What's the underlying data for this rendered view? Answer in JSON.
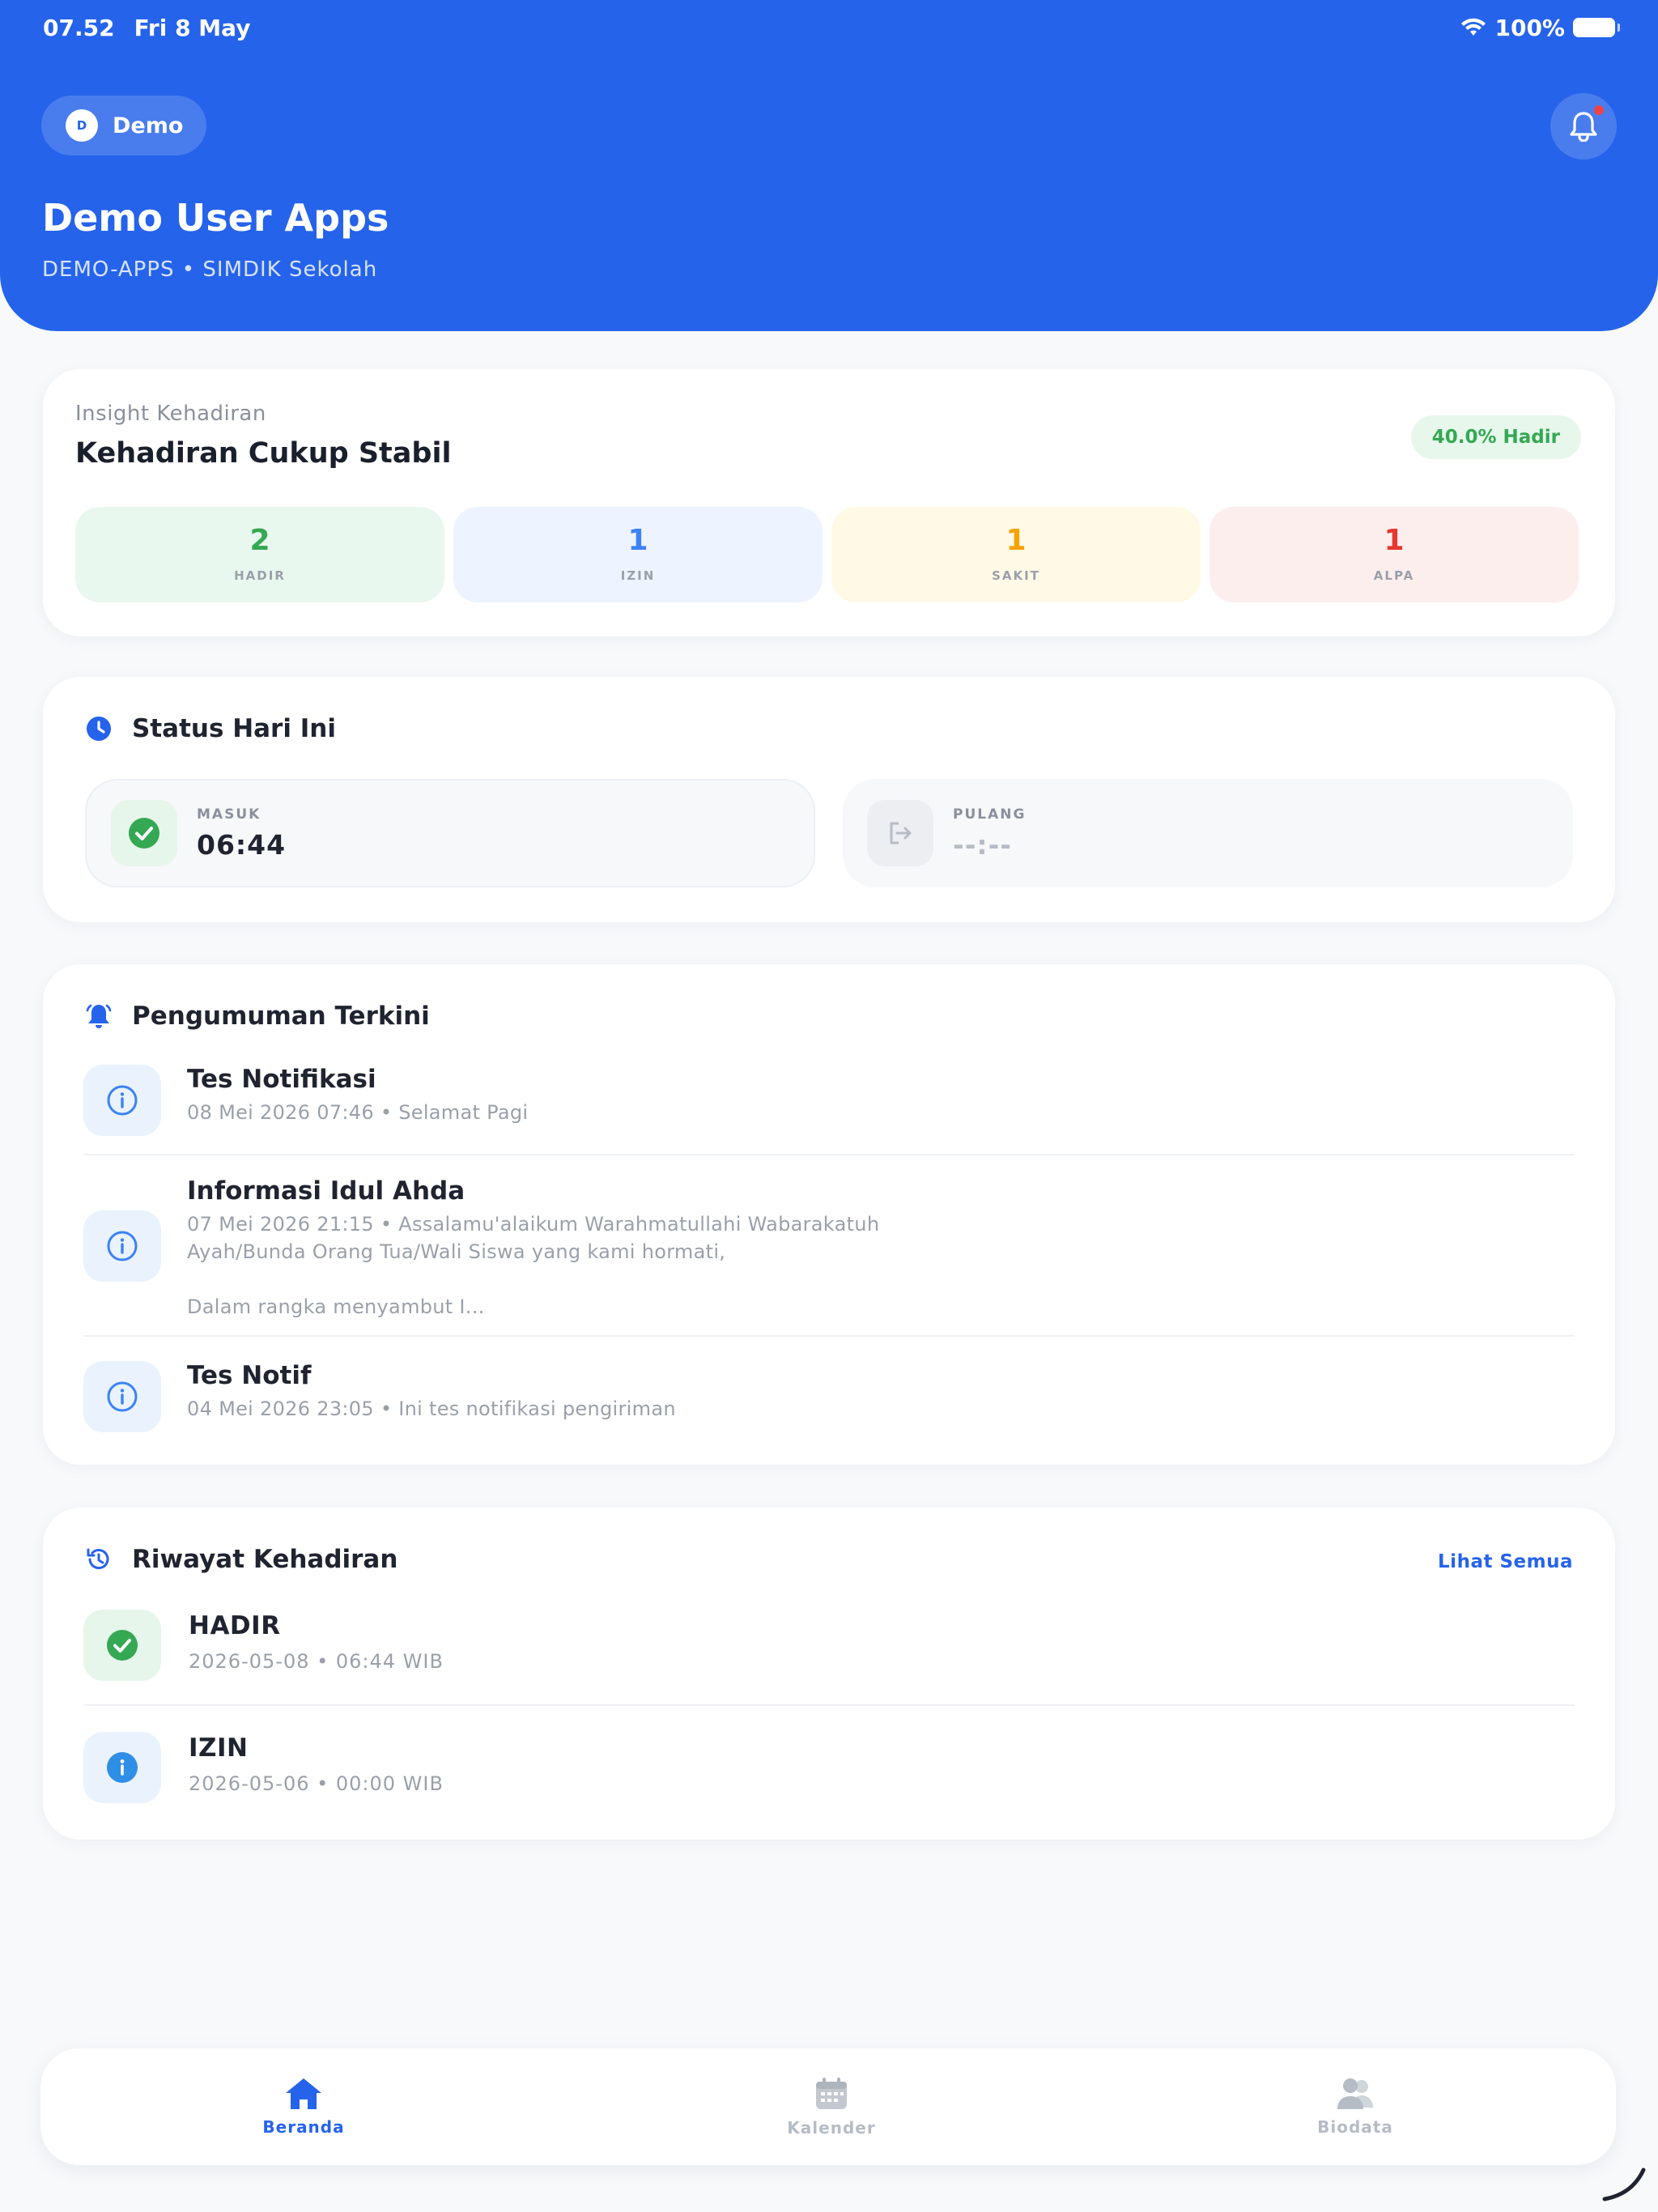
{
  "status_bar": {
    "time": "07.52",
    "date": "Fri 8 May",
    "battery": "100%"
  },
  "header": {
    "chip_initial": "D",
    "chip_label": "Demo",
    "title": "Demo User Apps",
    "subtitle": "DEMO-APPS • SIMDIK Sekolah"
  },
  "insight": {
    "eyebrow": "Insight Kehadiran",
    "title": "Kehadiran Cukup Stabil",
    "badge": "40.0% Hadir",
    "stats": [
      {
        "value": "2",
        "label": "HADIR",
        "color": "#34a853",
        "bg": "#e9f8ee"
      },
      {
        "value": "1",
        "label": "IZIN",
        "color": "#3b82f6",
        "bg": "#edf4ff"
      },
      {
        "value": "1",
        "label": "SAKIT",
        "color": "#f5a300",
        "bg": "#fff9e6"
      },
      {
        "value": "1",
        "label": "ALPA",
        "color": "#e5372e",
        "bg": "#fdeeee"
      }
    ]
  },
  "status_today": {
    "title": "Status Hari Ini",
    "masuk_label": "MASUK",
    "masuk_value": "06:44",
    "pulang_label": "PULANG",
    "pulang_value": "--:--"
  },
  "announcements": {
    "title": "Pengumuman Terkini",
    "items": [
      {
        "title": "Tes Notifikasi",
        "meta": "08 Mei 2026 07:46 • Selamat Pagi"
      },
      {
        "title": "Informasi Idul Ahda",
        "meta": "07 Mei 2026 21:15 • Assalamu'alaikum Warahmatullahi Wabarakatuh\nAyah/Bunda Orang Tua/Wali Siswa yang kami hormati,\n\nDalam rangka menyambut I..."
      },
      {
        "title": "Tes Notif",
        "meta": "04 Mei 2026 23:05 • Ini tes notifikasi pengiriman"
      }
    ]
  },
  "history": {
    "title": "Riwayat Kehadiran",
    "see_all": "Lihat Semua",
    "items": [
      {
        "status": "HADIR",
        "meta": "2026-05-08 • 06:44 WIB",
        "icon": "check-circle-icon"
      },
      {
        "status": "IZIN",
        "meta": "2026-05-06 • 00:00 WIB",
        "icon": "info-circle-icon"
      }
    ]
  },
  "nav": {
    "items": [
      {
        "label": "Beranda",
        "icon": "home-icon",
        "active": true
      },
      {
        "label": "Kalender",
        "icon": "calendar-icon",
        "active": false
      },
      {
        "label": "Biodata",
        "icon": "users-icon",
        "active": false
      }
    ],
    "active_color": "#2563eb",
    "inactive_color": "#b6bcc6"
  },
  "colors": {
    "primary": "#2563eb",
    "background": "#f8f9fb"
  }
}
